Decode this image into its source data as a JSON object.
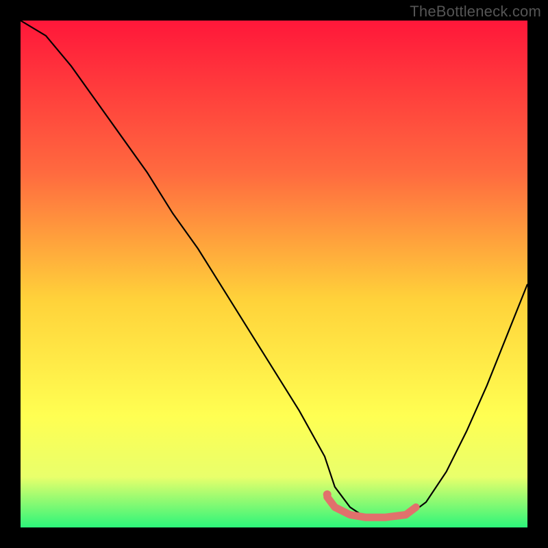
{
  "watermark": "TheBottleneck.com",
  "colors": {
    "bg": "#000000",
    "grad_top": "#ff173a",
    "grad_mid1": "#ff6a3f",
    "grad_mid2": "#ffd23a",
    "grad_mid3": "#ffff52",
    "grad_mid4": "#e9ff6b",
    "grad_bottom": "#2cf57a",
    "curve": "#000000",
    "accent": "#e1716c",
    "accent_dot": "#e1716c"
  },
  "chart_data": {
    "type": "line",
    "title": "",
    "xlabel": "",
    "ylabel": "",
    "xlim": [
      0,
      100
    ],
    "ylim": [
      0,
      100
    ],
    "series": [
      {
        "name": "curve",
        "x": [
          0,
          5,
          10,
          15,
          20,
          25,
          30,
          35,
          40,
          45,
          50,
          55,
          60,
          62,
          65,
          68,
          72,
          76,
          80,
          84,
          88,
          92,
          96,
          100
        ],
        "y": [
          100,
          97,
          91,
          84,
          77,
          70,
          62,
          55,
          47,
          39,
          31,
          23,
          14,
          8,
          4,
          2,
          2,
          2,
          5,
          11,
          19,
          28,
          38,
          48
        ]
      },
      {
        "name": "accent-segment",
        "x": [
          60.5,
          62,
          65,
          68,
          72,
          76,
          78
        ],
        "y": [
          6,
          4,
          2.5,
          2,
          2,
          2.5,
          4
        ]
      }
    ],
    "annotations": [
      {
        "name": "accent-dot",
        "x": 60.5,
        "y": 6.5
      }
    ]
  }
}
